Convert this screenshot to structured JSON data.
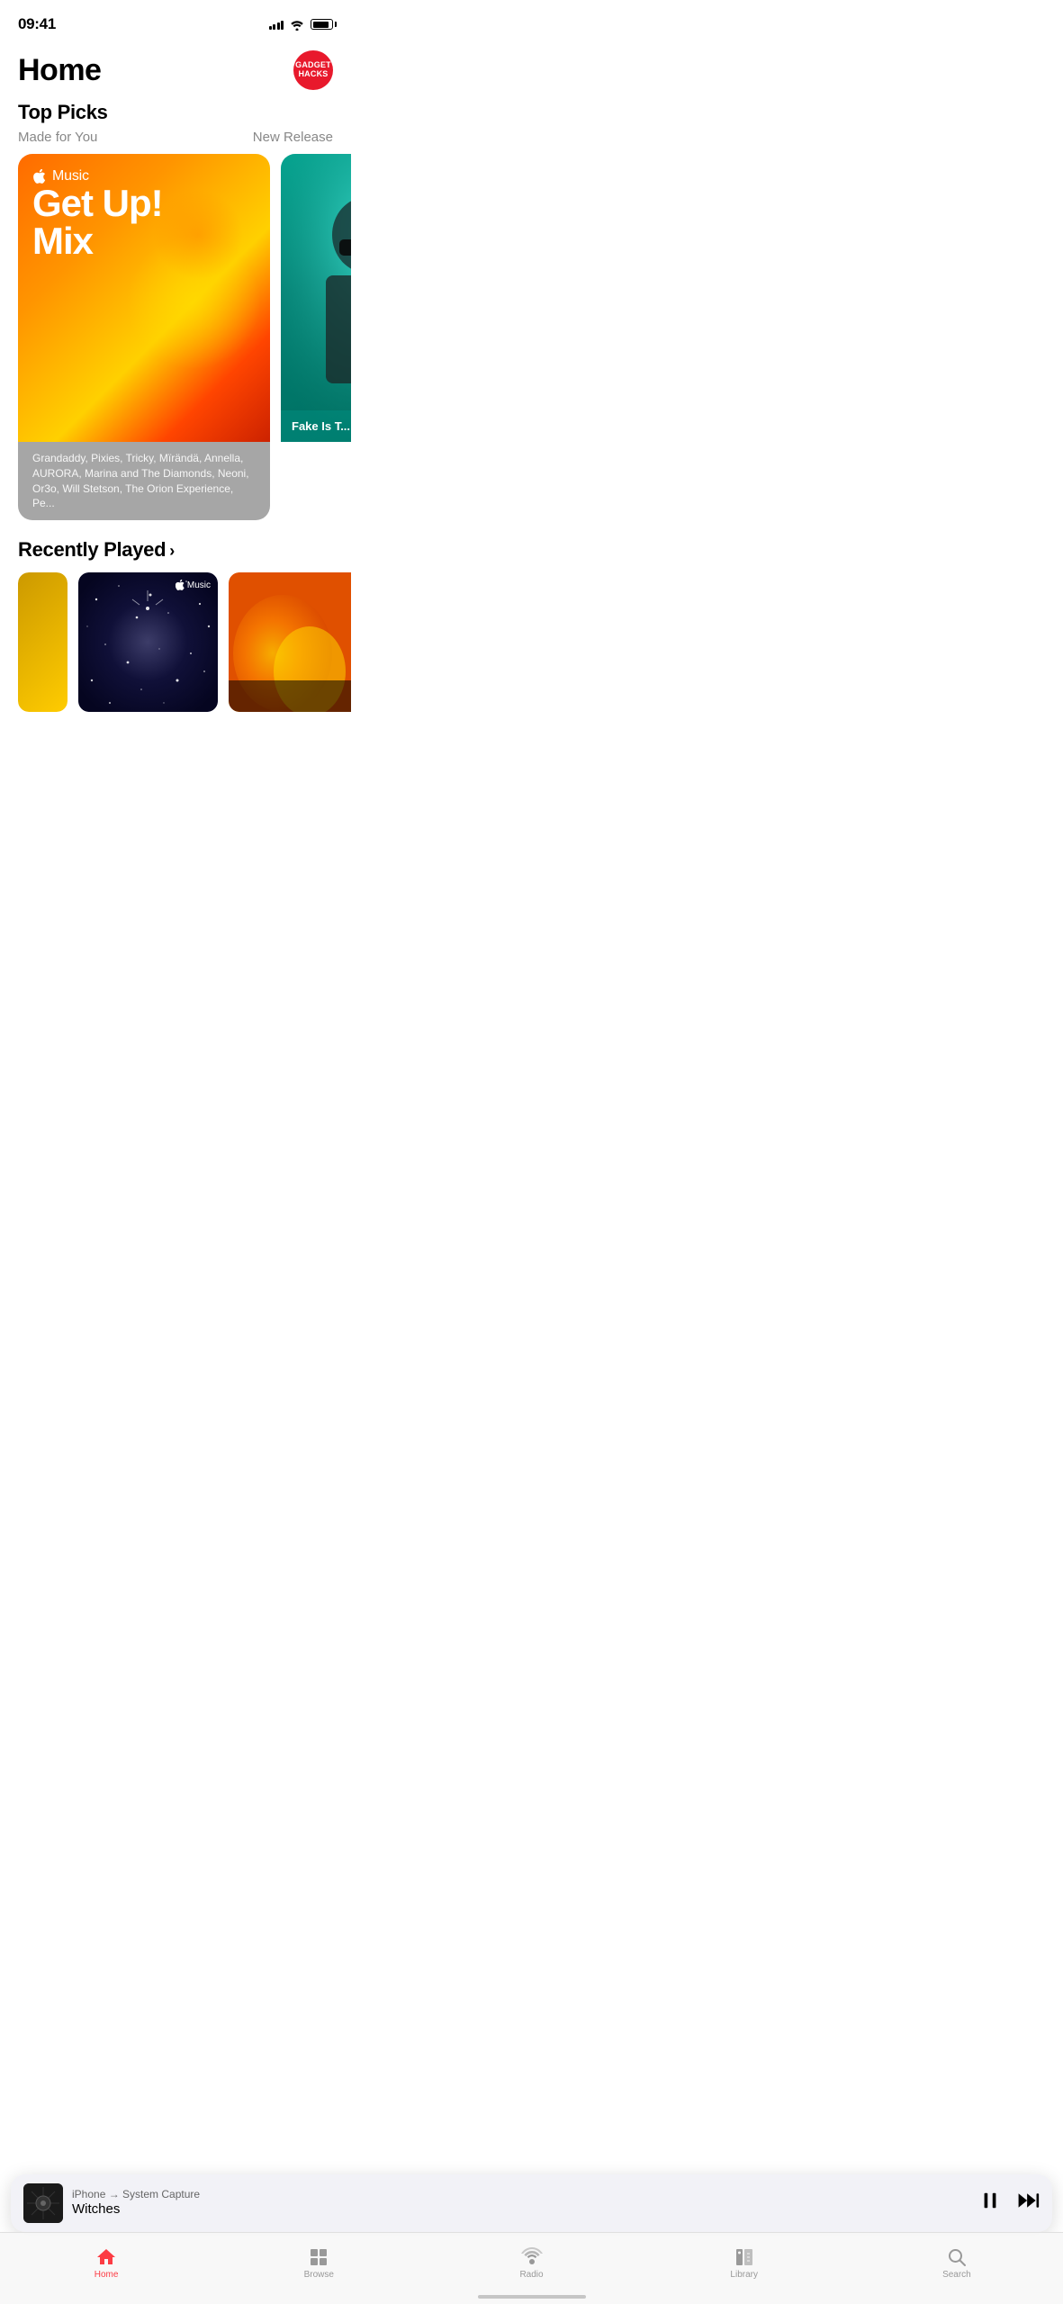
{
  "status": {
    "time": "09:41",
    "signal_bars": [
      4,
      6,
      8,
      10,
      12
    ],
    "battery_percent": 85
  },
  "header": {
    "title": "Home",
    "avatar_line1": "GADGET",
    "avatar_line2": "HACKS",
    "avatar_color": "#e8192c"
  },
  "top_picks": {
    "section_title": "Top Picks",
    "subtitle_left": "Made for You",
    "subtitle_right": "New Release",
    "main_card": {
      "brand_icon": "",
      "brand_name": "Music",
      "title_line1": "Get Up!",
      "title_line2": "Mix",
      "description": "Grandaddy, Pixies, Tricky, Mïrändä, Annella, AURORA, Marina and The Diamonds, Neoni, Or3o, Will Stetson, The Orion Experience, Pe..."
    },
    "second_card": {
      "text": "Fake Is T..."
    }
  },
  "recently_played": {
    "section_title": "Recently Played",
    "chevron": "›",
    "cards": [
      {
        "id": 1,
        "type": "small_partial",
        "bg_color": "#cc9900"
      },
      {
        "id": 2,
        "type": "stars",
        "badge": " Music",
        "has_apple": true
      },
      {
        "id": 3,
        "type": "orange_flame",
        "has_overlay": true
      }
    ]
  },
  "mini_player": {
    "source": "iPhone → System Capture",
    "song": "Witches",
    "pause_icon": "⏸",
    "forward_icon": "⏩"
  },
  "tab_bar": {
    "tabs": [
      {
        "id": "home",
        "label": "Home",
        "icon": "house",
        "active": true
      },
      {
        "id": "browse",
        "label": "Browse",
        "icon": "browse",
        "active": false
      },
      {
        "id": "radio",
        "label": "Radio",
        "icon": "radio",
        "active": false
      },
      {
        "id": "library",
        "label": "Library",
        "icon": "library",
        "active": false
      },
      {
        "id": "search",
        "label": "Search",
        "icon": "search",
        "active": false
      }
    ]
  }
}
